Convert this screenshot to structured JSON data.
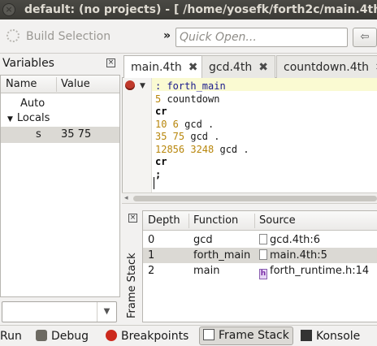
{
  "window": {
    "title": "default:  (no projects) - [ /home/yosefk/forth2c/main.4th ]",
    "close_glyph": "×"
  },
  "toolbar": {
    "build_label": "Build Selection",
    "chevron": "»",
    "quick_open_placeholder": "Quick Open...",
    "nav_glyph": "⇦"
  },
  "variables": {
    "title": "Variables",
    "close_glyph": "×",
    "col_name": "Name",
    "col_value": "Value",
    "auto": "Auto",
    "locals_arrow": "▼",
    "locals": "Locals",
    "row": {
      "name": "s",
      "value": "35 75"
    },
    "combo_arrow": "▼"
  },
  "tabs": [
    {
      "label": "main.4th",
      "close": "✖"
    },
    {
      "label": "gcd.4th",
      "close": "✖"
    },
    {
      "label": "countdown.4th",
      "close": "✖"
    }
  ],
  "editor": {
    "fold_glyph": "▼",
    "lines": [
      {
        "a": ": ",
        "b": "forth_main",
        "c": ""
      },
      {
        "a": "5",
        "b": " countdown",
        "c": ""
      },
      {
        "a": "",
        "b": "",
        "c": "cr"
      },
      {
        "a": "10 6",
        "b": " gcd .",
        "c": ""
      },
      {
        "a": "35 75",
        "b": " gcd .",
        "c": ""
      },
      {
        "a": "12856 3248",
        "b": " gcd .",
        "c": ""
      },
      {
        "a": "",
        "b": "",
        "c": "cr"
      },
      {
        "a": "",
        "b": "",
        "c": ";"
      }
    ],
    "hscroll_arrow": "◂"
  },
  "frame_stack": {
    "label": "Frame Stack",
    "close_glyph": "×",
    "columns": [
      "Depth",
      "Function",
      "Source"
    ],
    "rows": [
      {
        "depth": "0",
        "function": "gcd",
        "source": "gcd.4th:6",
        "icon": "file-icon"
      },
      {
        "depth": "1",
        "function": "forth_main",
        "source": "main.4th:5",
        "icon": "file-icon",
        "selected": true
      },
      {
        "depth": "2",
        "function": "main",
        "source": "forth_runtime.h:14",
        "icon": "header-file-icon",
        "icon_glyph": "h"
      }
    ]
  },
  "bottom_tabs": [
    {
      "label": "Run"
    },
    {
      "label": "Debug"
    },
    {
      "label": "Breakpoints"
    },
    {
      "label": "Frame Stack",
      "active": true
    },
    {
      "label": "Konsole"
    }
  ],
  "colors": {
    "titlebar": "#3b3a36",
    "selection": "#dbd9d4",
    "keyword": "#1a1a8c",
    "number": "#b8860b",
    "breakpoint": "#cc2a1d"
  }
}
